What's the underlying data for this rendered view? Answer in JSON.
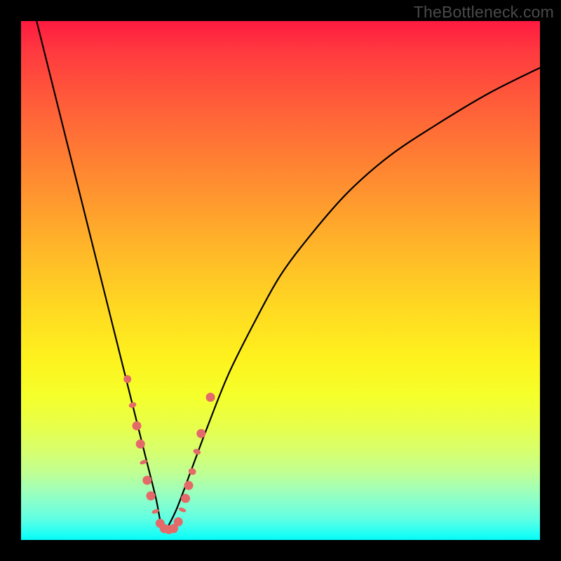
{
  "watermark": "TheBottleneck.com",
  "colors": {
    "frame": "#000000",
    "curve": "#000000",
    "marker": "#e46a6a"
  },
  "chart_data": {
    "type": "line",
    "title": "",
    "xlabel": "",
    "ylabel": "",
    "xlim": [
      0,
      100
    ],
    "ylim": [
      0,
      100
    ],
    "grid": false,
    "legend": false,
    "note": "Bottleneck-style V curve. x is a component-ratio axis (0–100), y is percent bottleneck (0 at bottom = no bottleneck, 100 at top = severe). Two branches meet at a minimum near x≈27, y≈2.",
    "series": [
      {
        "name": "left-branch",
        "x": [
          3,
          6,
          9,
          12,
          15,
          18,
          20,
          22,
          24,
          26,
          27,
          28
        ],
        "y": [
          100,
          88,
          76,
          64,
          52,
          40,
          32,
          24,
          16,
          8,
          3,
          2
        ]
      },
      {
        "name": "right-branch",
        "x": [
          28,
          30,
          33,
          36,
          40,
          45,
          50,
          56,
          63,
          71,
          80,
          90,
          100
        ],
        "y": [
          2,
          6,
          14,
          22,
          32,
          42,
          51,
          59,
          67,
          74,
          80,
          86,
          91
        ]
      }
    ],
    "markers": {
      "note": "Salmon dots/lozenges clustered near the minimum (approx positions on same x/y scale).",
      "points": [
        {
          "x": 20.5,
          "y": 31,
          "shape": "lozenge",
          "len": 6
        },
        {
          "x": 21.5,
          "y": 26,
          "shape": "lozenge",
          "len": 4
        },
        {
          "x": 22.3,
          "y": 22,
          "shape": "dot"
        },
        {
          "x": 23.0,
          "y": 18.5,
          "shape": "dot"
        },
        {
          "x": 23.6,
          "y": 15,
          "shape": "lozenge",
          "len": 3
        },
        {
          "x": 24.3,
          "y": 11.5,
          "shape": "dot"
        },
        {
          "x": 25.0,
          "y": 8.5,
          "shape": "dot"
        },
        {
          "x": 25.9,
          "y": 5.5,
          "shape": "lozenge",
          "len": 3
        },
        {
          "x": 26.8,
          "y": 3.2,
          "shape": "dot"
        },
        {
          "x": 27.6,
          "y": 2.2,
          "shape": "dot"
        },
        {
          "x": 28.5,
          "y": 2.0,
          "shape": "dot"
        },
        {
          "x": 29.4,
          "y": 2.2,
          "shape": "dot"
        },
        {
          "x": 30.3,
          "y": 3.5,
          "shape": "dot"
        },
        {
          "x": 31.1,
          "y": 5.8,
          "shape": "lozenge",
          "len": 3
        },
        {
          "x": 31.7,
          "y": 8.0,
          "shape": "dot"
        },
        {
          "x": 32.3,
          "y": 10.5,
          "shape": "dot"
        },
        {
          "x": 33.0,
          "y": 13.2,
          "shape": "lozenge",
          "len": 5
        },
        {
          "x": 33.9,
          "y": 17.0,
          "shape": "lozenge",
          "len": 4
        },
        {
          "x": 34.7,
          "y": 20.5,
          "shape": "dot"
        },
        {
          "x": 36.5,
          "y": 27.5,
          "shape": "dot"
        }
      ]
    }
  }
}
